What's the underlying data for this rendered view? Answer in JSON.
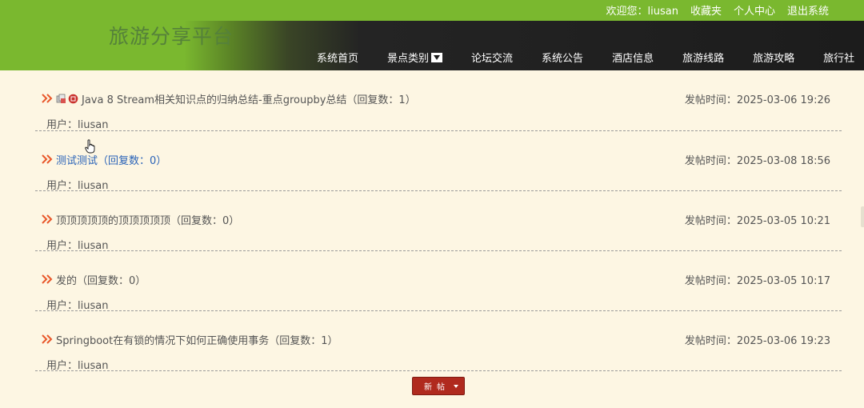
{
  "header": {
    "site_title": "旅游分享平台",
    "welcome": "欢迎您：liusan",
    "favorites": "收藏夹",
    "profile": "个人中心",
    "logout": "退出系统"
  },
  "nav": [
    {
      "label": "系统首页",
      "has_dropdown": false
    },
    {
      "label": "景点类别",
      "has_dropdown": true
    },
    {
      "label": "论坛交流",
      "has_dropdown": false
    },
    {
      "label": "系统公告",
      "has_dropdown": false
    },
    {
      "label": "酒店信息",
      "has_dropdown": false
    },
    {
      "label": "旅游线路",
      "has_dropdown": false
    },
    {
      "label": "旅游攻略",
      "has_dropdown": false
    },
    {
      "label": "旅行社",
      "has_dropdown": false
    }
  ],
  "posts": [
    {
      "title": "Java 8 Stream相关知识点的归纳总结-重点groupby总结（回复数：1）",
      "time": "发帖时间：2025-03-06 19:26",
      "author": "用户：liusan",
      "has_icons": true,
      "hovered": false
    },
    {
      "title": "测试测试（回复数：0）",
      "time": "发帖时间：2025-03-08 18:56",
      "author": "用户：liusan",
      "has_icons": false,
      "hovered": true
    },
    {
      "title": "顶顶顶顶顶的顶顶顶顶顶（回复数：0）",
      "time": "发帖时间：2025-03-05 10:21",
      "author": "用户：liusan",
      "has_icons": false,
      "hovered": false
    },
    {
      "title": "发的（回复数：0）",
      "time": "发帖时间：2025-03-05 10:17",
      "author": "用户：liusan",
      "has_icons": false,
      "hovered": false
    },
    {
      "title": "Springboot在有锁的情况下如何正确使用事务（回复数：1）",
      "time": "发帖时间：2025-03-06 19:23",
      "author": "用户：liusan",
      "has_icons": false,
      "hovered": false
    }
  ],
  "new_post_button": "新帖",
  "colors": {
    "header_green": "#7ab82f",
    "header_dark": "#1c1c1c",
    "link_blue": "#2a63b8",
    "arrow_orange": "#e8572a",
    "button_red": "#b02a1e",
    "page_bg": "#fdf6e3"
  }
}
